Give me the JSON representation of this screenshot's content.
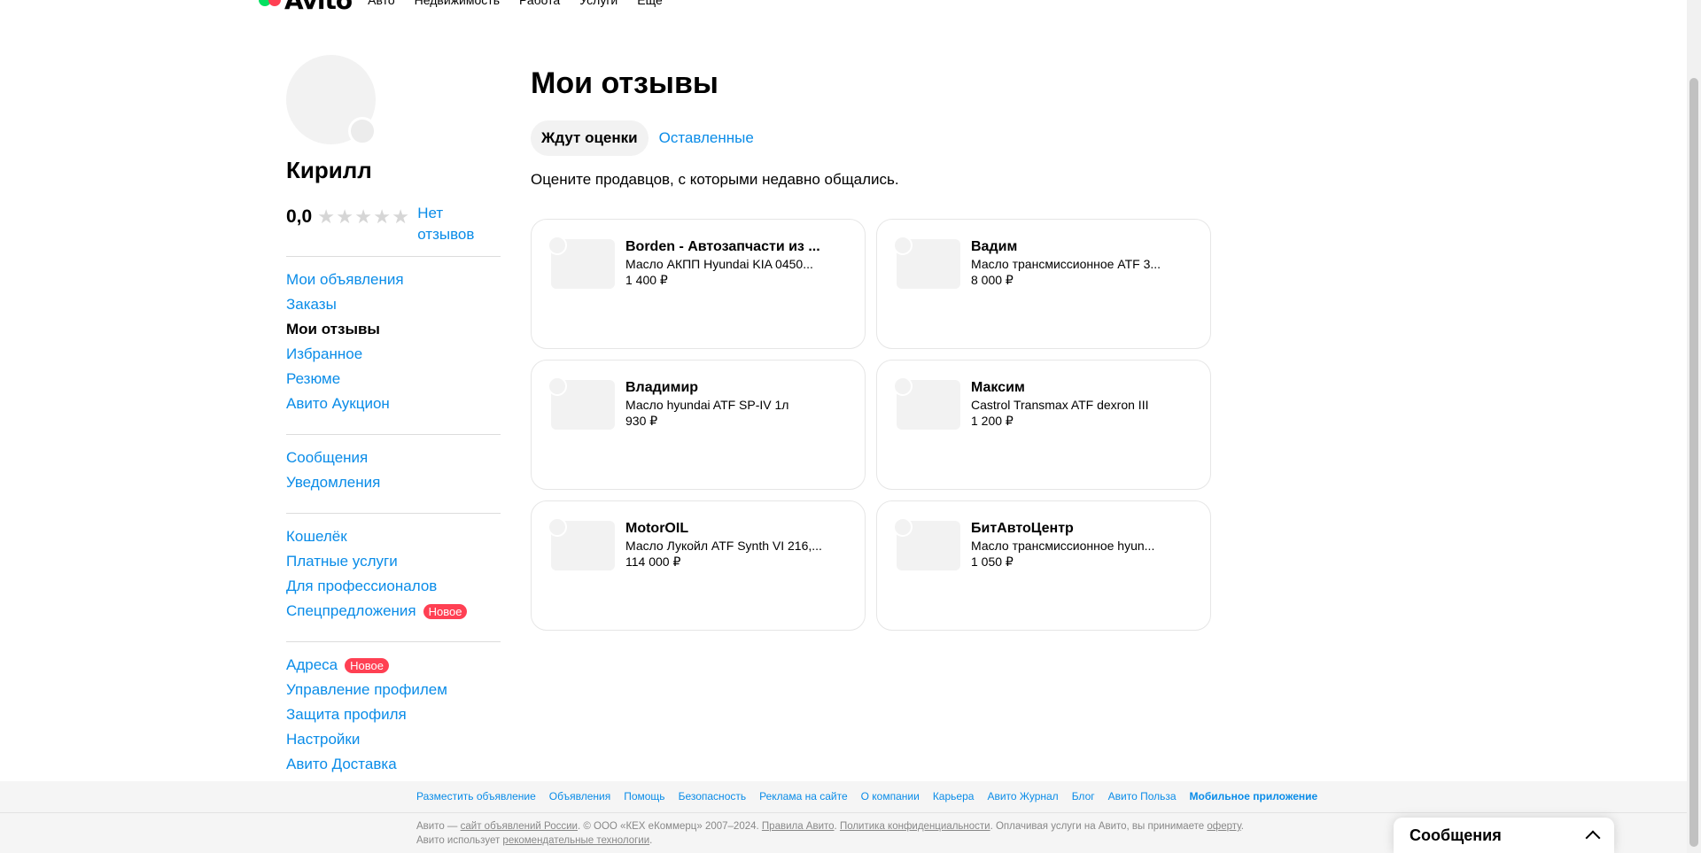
{
  "topnav": {
    "logo_text": "Avito",
    "links": [
      "Авто",
      "Недвижимость",
      "Работа",
      "Услуги",
      "Еще"
    ]
  },
  "profile": {
    "name": "Кирилл",
    "rating": "0,0",
    "rating_stars": 0,
    "no_reviews": "Нет отзывов"
  },
  "sidebar": {
    "groups": [
      [
        {
          "label": "Мои объявления",
          "active": false
        },
        {
          "label": "Заказы",
          "active": false
        },
        {
          "label": "Мои отзывы",
          "active": true
        },
        {
          "label": "Избранное",
          "active": false
        },
        {
          "label": "Резюме",
          "active": false
        },
        {
          "label": "Авито Аукцион",
          "active": false
        }
      ],
      [
        {
          "label": "Сообщения",
          "active": false
        },
        {
          "label": "Уведомления",
          "active": false
        }
      ],
      [
        {
          "label": "Кошелёк",
          "active": false
        },
        {
          "label": "Платные услуги",
          "active": false
        },
        {
          "label": "Для профессионалов",
          "active": false
        },
        {
          "label": "Спецпредложения",
          "active": false,
          "badge": "Новое"
        }
      ],
      [
        {
          "label": "Адреса",
          "active": false,
          "badge": "Новое"
        },
        {
          "label": "Управление профилем",
          "active": false
        },
        {
          "label": "Защита профиля",
          "active": false
        },
        {
          "label": "Настройки",
          "active": false
        },
        {
          "label": "Авито Доставка",
          "active": false
        }
      ]
    ]
  },
  "main": {
    "title": "Мои отзывы",
    "tabs": [
      {
        "label": "Ждут оценки",
        "active": true
      },
      {
        "label": "Оставленные",
        "active": false
      }
    ],
    "subtitle": "Оцените продавцов, с которыми недавно общались."
  },
  "cards": [
    {
      "seller": "Borden - Автозапчасти из ...",
      "title": "Масло АКПП Hyundai KIA 0450...",
      "price": "1 400 ₽"
    },
    {
      "seller": "Вадим",
      "title": "Масло трансмиссионное ATF 3...",
      "price": "8 000 ₽"
    },
    {
      "seller": "Владимир",
      "title": "Масло hyundai ATF SP-IV 1л",
      "price": "930 ₽"
    },
    {
      "seller": "Максим",
      "title": "Castrol Transmax ATF dexron III",
      "price": "1 200 ₽"
    },
    {
      "seller": "MotorOIL",
      "title": "Масло Лукойл ATF Synth VI 216,...",
      "price": "114 000 ₽"
    },
    {
      "seller": "БитАвтоЦентр",
      "title": "Масло трансмиссионное hyun...",
      "price": "1 050 ₽"
    }
  ],
  "footer": {
    "links": [
      {
        "label": "Разместить объявление",
        "bold": false
      },
      {
        "label": "Объявления",
        "bold": false
      },
      {
        "label": "Помощь",
        "bold": false
      },
      {
        "label": "Безопасность",
        "bold": false
      },
      {
        "label": "Реклама на сайте",
        "bold": false
      },
      {
        "label": "О компании",
        "bold": false
      },
      {
        "label": "Карьера",
        "bold": false
      },
      {
        "label": "Авито Журнал",
        "bold": false
      },
      {
        "label": "Блог",
        "bold": false
      },
      {
        "label": "Авито Польза",
        "bold": false
      },
      {
        "label": "Мобильное приложение",
        "bold": true
      }
    ],
    "legal": {
      "t1": "Авито — ",
      "l1": "сайт объявлений России",
      "t2": ". © ООО «КЕХ еКоммерц» 2007–2024. ",
      "l2": "Правила Авито",
      "t3": ". ",
      "l3": "Политика конфиденциальности",
      "t4": ". Оплачивая услуги на Авито, вы принимаете ",
      "l4": "оферту",
      "t5": ". Авито использует ",
      "l5": "рекомендательные технологии",
      "t6": "."
    }
  },
  "messages_widget": {
    "title": "Сообщения"
  },
  "colors": {
    "accent": "#0a8ce8",
    "badge": "#ff4053",
    "card_border": "#e6e6e6"
  }
}
